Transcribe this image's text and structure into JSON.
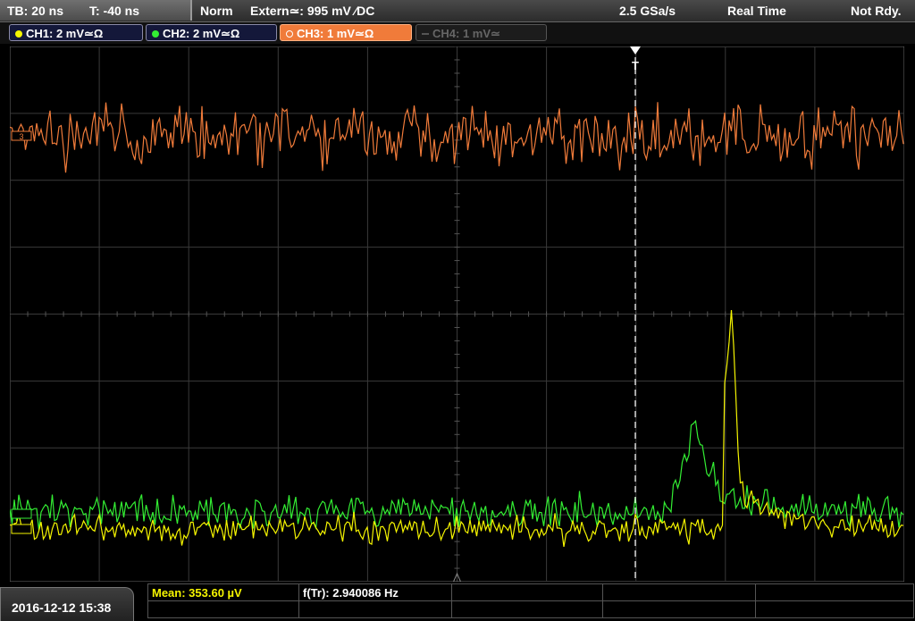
{
  "statusbar": {
    "timebase": "TB: 20 ns",
    "trigger_time": "T: -40 ns",
    "trigger_mode": "Norm",
    "trigger_source": "Extern≃: 995 mV ∕DC",
    "sample_rate": "2.5 GSa/s",
    "acquisition_mode": "Real Time",
    "status": "Not Rdy."
  },
  "channels": [
    {
      "label": "CH1: 2 mV≃Ω",
      "color": "#f5f500",
      "active": true
    },
    {
      "label": "CH2: 2 mV≃Ω",
      "color": "#33ee33",
      "active": true
    },
    {
      "label": "CH3: 1 mV≃Ω",
      "color": "#f07b3a",
      "active": true,
      "selected": true
    },
    {
      "label": "CH4: 1 mV≃",
      "color": "#555555",
      "active": false
    }
  ],
  "plot": {
    "trigger_marker": "T",
    "ch3_marker": "3"
  },
  "measurements": {
    "mean_label": "Mean: 353.60 µV",
    "freq_label": "f(Tr): 2.940086 Hz"
  },
  "datetime": "2016-12-12 15:38"
}
